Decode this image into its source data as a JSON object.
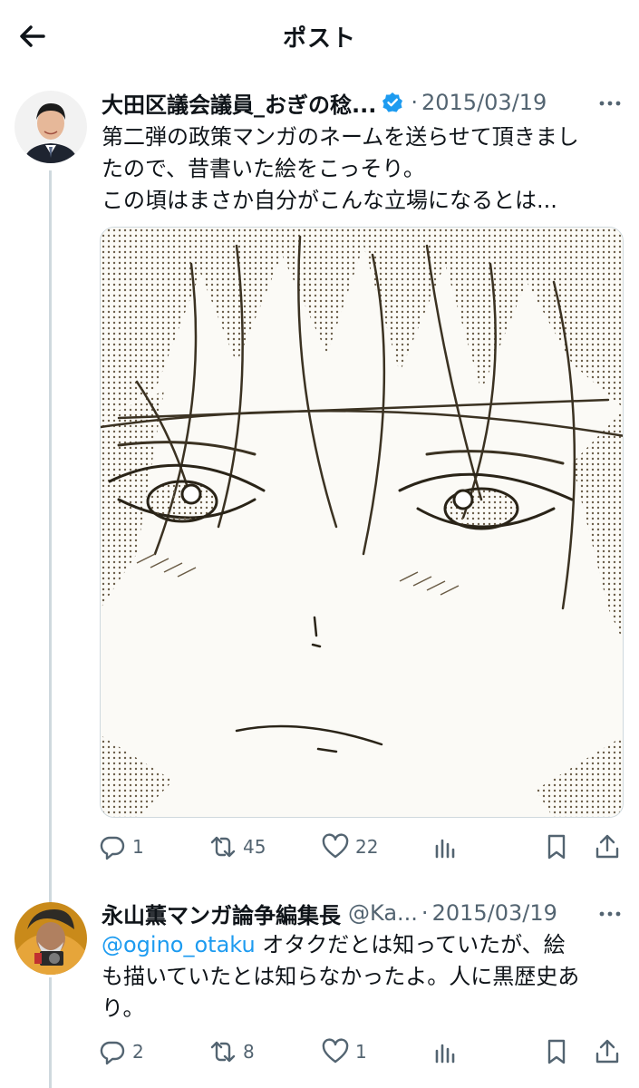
{
  "header": {
    "title": "ポスト",
    "back_icon": "arrow-left-icon"
  },
  "tweets": [
    {
      "author_name": "大田区議会議員_おぎの稔...",
      "verified": true,
      "handle": "",
      "date": "2015/03/19",
      "text_lines": [
        "第二弾の政策マンガのネームを送らせて頂きまし",
        "たので、昔書いた絵をこっそり。",
        "この頃はまさか自分がこんな立場になるとは..."
      ],
      "media_description": "manga sketch",
      "replies": "1",
      "reposts": "45",
      "likes": "22"
    },
    {
      "author_name": "永山薫マンガ論争編集長",
      "verified": false,
      "handle": "@Ka...",
      "date": "2015/03/19",
      "mention": "@ogino_otaku",
      "text_lines": [
        " オタクだとは知っていたが、絵",
        "も描いていたとは知らなかったよ。人に黒歴史あ",
        "り。"
      ],
      "replies": "2",
      "reposts": "8",
      "likes": "1"
    }
  ],
  "colors": {
    "accent": "#1d9bf0",
    "secondary_text": "#536471",
    "thread_line": "#cfd9de"
  }
}
